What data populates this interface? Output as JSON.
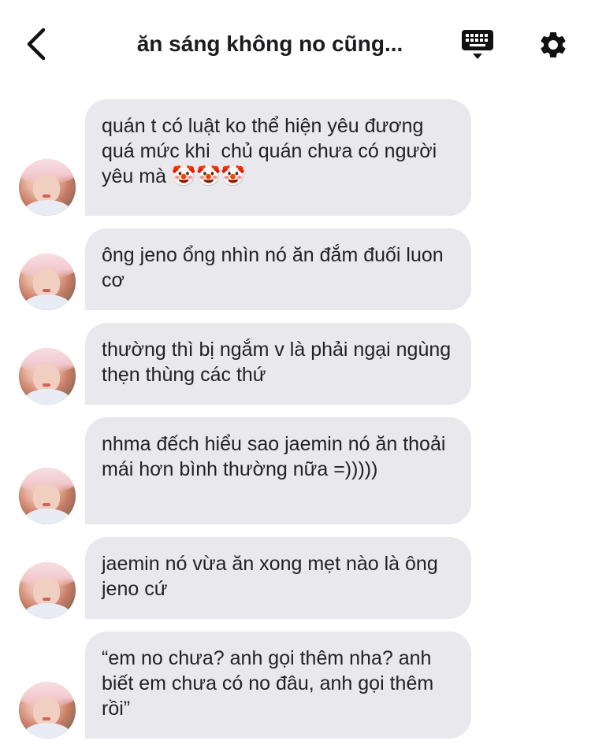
{
  "header": {
    "title": "ăn sáng không no cũng...",
    "back_icon": "chevron-left-icon",
    "keyboard_icon": "keyboard-icon",
    "settings_icon": "gear-icon"
  },
  "messages": [
    {
      "text": "quán t có luật ko thể hiện yêu đương quá mức khi  chủ quán chưa có người yêu mà 🤡🤡🤡"
    },
    {
      "text": "ông jeno ổng nhìn nó ăn đắm đuối luon cơ"
    },
    {
      "text": "thường thì bị ngắm v là phải ngại ngùng thẹn thùng các thứ"
    },
    {
      "text": "nhma đếch hiểu sao jaemin nó ăn thoải mái hơn bình thường nữa =)))))"
    },
    {
      "text": "jaemin nó vừa ăn xong mẹt nào là ông jeno cứ"
    },
    {
      "text": "“em no chưa? anh gọi thêm nha? anh biết em chưa có no đâu, anh gọi thêm rồi”"
    }
  ],
  "colors": {
    "bubble_bg": "#e8e8ed",
    "text": "#222224",
    "icon": "#111111"
  }
}
